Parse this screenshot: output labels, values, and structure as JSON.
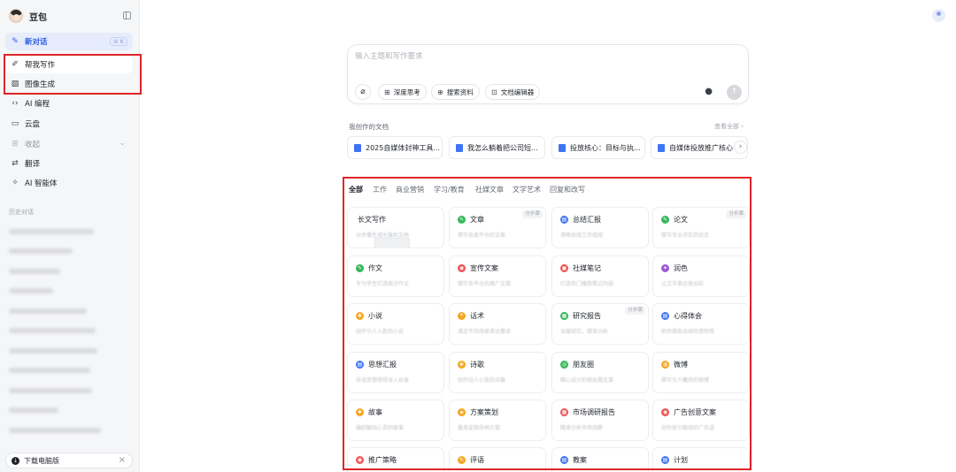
{
  "sidebar": {
    "brand": "豆包",
    "new_chat": "新对话",
    "new_chat_shortcut": "⌘ K",
    "items": [
      {
        "label": "帮我写作"
      },
      {
        "label": "图像生成"
      },
      {
        "label": "AI 编程"
      },
      {
        "label": "云盘"
      },
      {
        "label": "收起"
      },
      {
        "label": "翻译"
      },
      {
        "label": "AI 智能体"
      }
    ],
    "history_title": "历史对话",
    "download_label": "下载电脑版"
  },
  "composer": {
    "placeholder": "输入主题和写作要求",
    "tools": [
      "深度思考",
      "搜索资料",
      "文档编辑器"
    ]
  },
  "docs": {
    "title": "我创作的文档",
    "more": "查看全部 ›",
    "items": [
      "2025自媒体封神工具...",
      "我怎么躺着把公司短...",
      "投放核心：目标与执...",
      "自媒体投放推广核心"
    ]
  },
  "tabs": [
    "全部",
    "工作",
    "商业营销",
    "学习/教育",
    "社媒文章",
    "文学艺术",
    "回复和改写"
  ],
  "cards": [
    {
      "title": "长文写作",
      "sub": "分步骤生成长篇和文档",
      "badge": "",
      "color": "",
      "icon": ""
    },
    {
      "title": "文章",
      "sub": "撰写各类平台的文章",
      "badge": "分步骤",
      "color": "#34b75a",
      "icon": "✎"
    },
    {
      "title": "总结汇报",
      "sub": "清晰总结工作成效",
      "badge": "",
      "color": "#3f74f5",
      "icon": "▤"
    },
    {
      "title": "论文",
      "sub": "撰写专业详实的论文",
      "badge": "分步骤",
      "color": "#34b75a",
      "icon": "✎"
    },
    {
      "title": "作文",
      "sub": "专为学生打造高分作文",
      "badge": "",
      "color": "#34b75a",
      "icon": "✎"
    },
    {
      "title": "宣传文案",
      "sub": "撰写各平台的推广文案",
      "badge": "",
      "color": "#f05252",
      "icon": "◉"
    },
    {
      "title": "社媒笔记",
      "sub": "打造热门爆款笔记内容",
      "badge": "",
      "color": "#f05252",
      "icon": "▣"
    },
    {
      "title": "润色",
      "sub": "让文字表达更出彩",
      "badge": "",
      "color": "#9b59d6",
      "icon": "✦"
    },
    {
      "title": "小说",
      "sub": "创作引人入胜的小说",
      "badge": "",
      "color": "#f5a623",
      "icon": "❖"
    },
    {
      "title": "话术",
      "sub": "满足不同场景表达需求",
      "badge": "",
      "color": "#f5a623",
      "icon": "❝"
    },
    {
      "title": "研究报告",
      "sub": "深度研究，精准分析",
      "badge": "分步骤",
      "color": "#34b75a",
      "icon": "▦"
    },
    {
      "title": "心得体会",
      "sub": "助你提炼总结所感所悟",
      "badge": "",
      "color": "#3f74f5",
      "icon": "▤"
    },
    {
      "title": "思想汇报",
      "sub": "诉说思想感悟深入自省",
      "badge": "",
      "color": "#3f74f5",
      "icon": "▤"
    },
    {
      "title": "诗歌",
      "sub": "创作动人心弦的诗篇",
      "badge": "",
      "color": "#f5a623",
      "icon": "❀"
    },
    {
      "title": "朋友圈",
      "sub": "精心设计的朋友圈文案",
      "badge": "",
      "color": "#34b75a",
      "icon": "◎"
    },
    {
      "title": "微博",
      "sub": "撰写引人瞩目的微博",
      "badge": "",
      "color": "#f5a623",
      "icon": "◍"
    },
    {
      "title": "故事",
      "sub": "编织触动心灵的故事",
      "badge": "",
      "color": "#f5a623",
      "icon": "❖"
    },
    {
      "title": "方案策划",
      "sub": "量身定制各种方案",
      "badge": "",
      "color": "#f5a623",
      "icon": "◈"
    },
    {
      "title": "市场调研报告",
      "sub": "精准分析市场洞察",
      "badge": "",
      "color": "#f05252",
      "icon": "▦"
    },
    {
      "title": "广告创意文案",
      "sub": "创作吸引眼球的广告语",
      "badge": "",
      "color": "#f05252",
      "icon": "◉"
    },
    {
      "title": "推广策略",
      "sub": "",
      "badge": "",
      "color": "#f05252",
      "icon": "◉"
    },
    {
      "title": "评语",
      "sub": "",
      "badge": "",
      "color": "#f5a623",
      "icon": "✎"
    },
    {
      "title": "教案",
      "sub": "",
      "badge": "",
      "color": "#3f74f5",
      "icon": "▤"
    },
    {
      "title": "计划",
      "sub": "",
      "badge": "",
      "color": "#3f74f5",
      "icon": "▤"
    }
  ]
}
